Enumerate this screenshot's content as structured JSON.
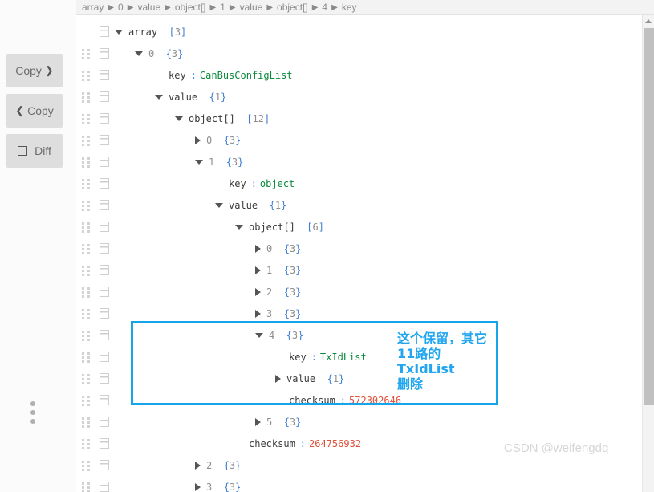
{
  "left_rail": {
    "copy_right_label": "Copy",
    "copy_right_icon": "chevron-right-icon",
    "copy_left_label": "Copy",
    "copy_left_icon": "chevron-left-icon",
    "diff_label": "Diff",
    "diff_icon": "square-icon",
    "menu_icon": "vertical-dots-icon"
  },
  "breadcrumb": {
    "separator": "▶",
    "items": [
      "array",
      "0",
      "value",
      "object[]",
      "1",
      "value",
      "object[]",
      "4",
      "key"
    ]
  },
  "tree": {
    "rows": [
      {
        "indent": 0,
        "toggle": "down",
        "name": "array",
        "meta": "[3]",
        "meta_kind": "array",
        "handle": false
      },
      {
        "indent": 1,
        "toggle": "down",
        "name": "0",
        "name_kind": "index",
        "meta": "{3}",
        "meta_kind": "object",
        "handle": true
      },
      {
        "indent": 2,
        "toggle": "none",
        "name": "key",
        "kv": true,
        "value": "CanBusConfigList",
        "value_kind": "string",
        "handle": true
      },
      {
        "indent": 2,
        "toggle": "down",
        "name": "value",
        "meta": "{1}",
        "meta_kind": "object",
        "handle": true
      },
      {
        "indent": 3,
        "toggle": "down",
        "name": "object[]",
        "meta": "[12]",
        "meta_kind": "array",
        "handle": true
      },
      {
        "indent": 4,
        "toggle": "right",
        "name": "0",
        "name_kind": "index",
        "meta": "{3}",
        "meta_kind": "object",
        "handle": true
      },
      {
        "indent": 4,
        "toggle": "down",
        "name": "1",
        "name_kind": "index",
        "meta": "{3}",
        "meta_kind": "object",
        "handle": true
      },
      {
        "indent": 5,
        "toggle": "none",
        "name": "key",
        "kv": true,
        "value": "object",
        "value_kind": "string",
        "handle": true
      },
      {
        "indent": 5,
        "toggle": "down",
        "name": "value",
        "meta": "{1}",
        "meta_kind": "object",
        "handle": true
      },
      {
        "indent": 6,
        "toggle": "down",
        "name": "object[]",
        "meta": "[6]",
        "meta_kind": "array",
        "handle": true
      },
      {
        "indent": 7,
        "toggle": "right",
        "name": "0",
        "name_kind": "index",
        "meta": "{3}",
        "meta_kind": "object",
        "handle": true
      },
      {
        "indent": 7,
        "toggle": "right",
        "name": "1",
        "name_kind": "index",
        "meta": "{3}",
        "meta_kind": "object",
        "handle": true
      },
      {
        "indent": 7,
        "toggle": "right",
        "name": "2",
        "name_kind": "index",
        "meta": "{3}",
        "meta_kind": "object",
        "handle": true
      },
      {
        "indent": 7,
        "toggle": "right",
        "name": "3",
        "name_kind": "index",
        "meta": "{3}",
        "meta_kind": "object",
        "handle": true
      },
      {
        "indent": 7,
        "toggle": "down",
        "name": "4",
        "name_kind": "index",
        "meta": "{3}",
        "meta_kind": "object",
        "handle": true
      },
      {
        "indent": 8,
        "toggle": "none",
        "name": "key",
        "kv": true,
        "value": "TxIdList",
        "value_kind": "string",
        "handle": true
      },
      {
        "indent": 8,
        "toggle": "right",
        "name": "value",
        "meta": "{1}",
        "meta_kind": "object",
        "handle": true
      },
      {
        "indent": 8,
        "toggle": "none",
        "name": "checksum",
        "kv": true,
        "value": "572302646",
        "value_kind": "number",
        "handle": true
      },
      {
        "indent": 7,
        "toggle": "right",
        "name": "5",
        "name_kind": "index",
        "meta": "{3}",
        "meta_kind": "object",
        "handle": true
      },
      {
        "indent": 6,
        "toggle": "none",
        "name": "checksum",
        "kv": true,
        "value": "264756932",
        "value_kind": "number",
        "handle": true
      },
      {
        "indent": 4,
        "toggle": "right",
        "name": "2",
        "name_kind": "index",
        "meta": "{3}",
        "meta_kind": "object",
        "handle": true
      },
      {
        "indent": 4,
        "toggle": "right",
        "name": "3",
        "name_kind": "index",
        "meta": "{3}",
        "meta_kind": "object",
        "handle": true
      }
    ]
  },
  "annotation": {
    "text": "这个保留，其它\n11路的TxIdList\n删除",
    "color": "#22a6ef"
  },
  "highlight": {
    "color": "#16a4ea"
  },
  "scrollbar": {
    "up_icon": "triangle-up-icon"
  },
  "watermark": {
    "text": "CSDN @weifengdq"
  }
}
